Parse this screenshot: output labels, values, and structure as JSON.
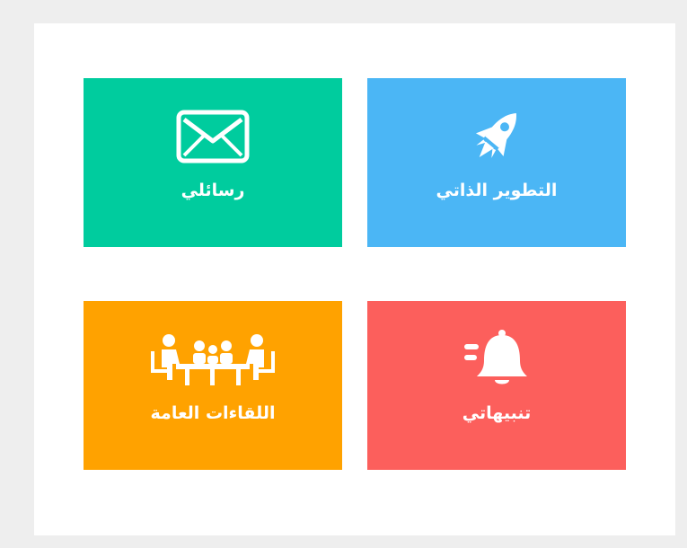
{
  "tiles": {
    "self_development": {
      "label": "التطوير الذاتي",
      "color": "#4bb6f5",
      "icon": "rocket-icon"
    },
    "messages": {
      "label": "رسائلي",
      "color": "#00cc9e",
      "icon": "envelope-icon"
    },
    "notifications": {
      "label": "تنبيهاتي",
      "color": "#fc5f5c",
      "icon": "bell-icon"
    },
    "public_meetings": {
      "label": "اللقاءات العامة",
      "color": "#ffa200",
      "icon": "meeting-icon"
    }
  }
}
